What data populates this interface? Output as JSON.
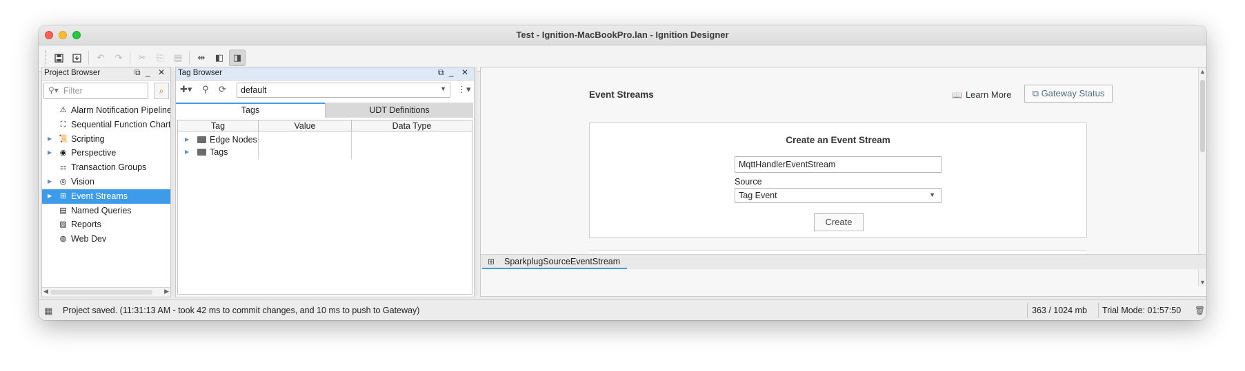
{
  "window": {
    "title": "Test - Ignition-MacBookPro.lan - Ignition Designer"
  },
  "project_browser": {
    "title": "Project Browser",
    "filter_placeholder": "Filter",
    "items": [
      {
        "label": "Alarm Notification Pipelines",
        "icon": "alarm-pipeline-icon",
        "expandable": false,
        "selected": false
      },
      {
        "label": "Sequential Function Charts",
        "icon": "sfc-icon",
        "expandable": false,
        "selected": false
      },
      {
        "label": "Scripting",
        "icon": "scripting-icon",
        "expandable": true,
        "selected": false
      },
      {
        "label": "Perspective",
        "icon": "perspective-icon",
        "expandable": true,
        "selected": false
      },
      {
        "label": "Transaction Groups",
        "icon": "transaction-groups-icon",
        "expandable": false,
        "selected": false
      },
      {
        "label": "Vision",
        "icon": "vision-icon",
        "expandable": true,
        "selected": false
      },
      {
        "label": "Event Streams",
        "icon": "event-streams-icon",
        "expandable": true,
        "selected": true
      },
      {
        "label": "Named Queries",
        "icon": "named-queries-icon",
        "expandable": false,
        "selected": false
      },
      {
        "label": "Reports",
        "icon": "reports-icon",
        "expandable": false,
        "selected": false
      },
      {
        "label": "Web Dev",
        "icon": "web-dev-icon",
        "expandable": false,
        "selected": false
      }
    ]
  },
  "tag_browser": {
    "title": "Tag Browser",
    "provider": "default",
    "tabs": [
      "Tags",
      "UDT Definitions"
    ],
    "columns": [
      "Tag",
      "Value",
      "Data Type"
    ],
    "rows": [
      "Edge Nodes",
      "Tags"
    ]
  },
  "event_streams": {
    "heading": "Event Streams",
    "learn_more": "Learn More",
    "gateway_status": "Gateway Status",
    "card_title": "Create an Event Stream",
    "name_value": "MqttHandlerEventStream",
    "source_label": "Source",
    "source_value": "Tag Event",
    "create_button": "Create"
  },
  "doc_tab": {
    "label": "SparkplugSourceEventStream"
  },
  "status_bar": {
    "message": "Project saved. (11:31:13 AM - took 42 ms to commit changes, and 10 ms to push to Gateway)",
    "memory": "363 / 1024 mb",
    "trial": "Trial Mode: 01:57:50"
  },
  "colors": {
    "accent": "#3d9be9",
    "selection": "#3d9be9"
  }
}
